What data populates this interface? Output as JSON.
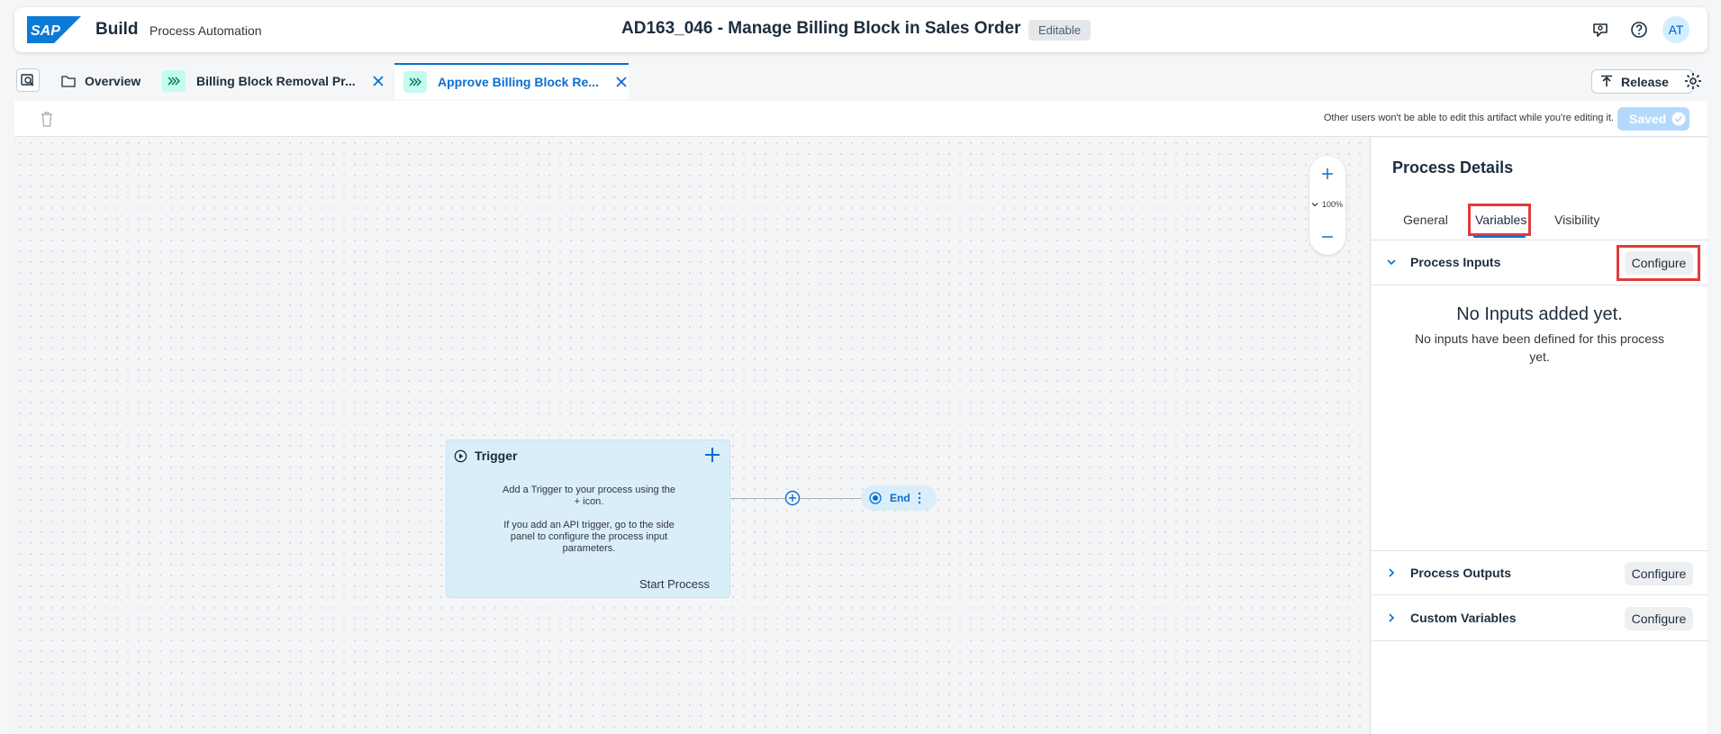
{
  "shell": {
    "logo_text": "SAP",
    "app_name": "Build",
    "app_sub": "Process Automation",
    "title": "AD163_046 - Manage Billing Block in Sales Order",
    "status_badge": "Editable",
    "avatar_initials": "AT",
    "icons": [
      "notifications-icon",
      "help-icon"
    ]
  },
  "tabs": {
    "overview_label": "Overview",
    "items": [
      {
        "label": "Billing Block Removal Pr...",
        "icon": "process-flow-icon",
        "active": false
      },
      {
        "label": "Approve Billing Block Re...",
        "icon": "process-flow-icon",
        "active": true
      }
    ],
    "release_label": "Release"
  },
  "toolbar": {
    "lock_note": "Other users won't be able to edit this artifact while you're editing it.",
    "saved_label": "Saved"
  },
  "canvas": {
    "zoom": "100%",
    "trigger": {
      "title": "Trigger",
      "desc_1": "Add a Trigger to your process using the + icon.",
      "desc_2": "If you add an API trigger, go to the side panel to configure the process input parameters.",
      "start_label": "Start Process"
    },
    "end_label": "End"
  },
  "panel": {
    "title": "Process Details",
    "tabs": [
      "General",
      "Variables",
      "Visibility"
    ],
    "active_tab": "Variables",
    "sections": [
      {
        "label": "Process Inputs",
        "expanded": true,
        "configure": "Configure"
      },
      {
        "label": "Process Outputs",
        "expanded": false,
        "configure": "Configure"
      },
      {
        "label": "Custom Variables",
        "expanded": false,
        "configure": "Configure"
      }
    ],
    "empty_title": "No Inputs added yet.",
    "empty_desc": "No inputs have been defined for this process yet."
  },
  "colors": {
    "accent": "#0a6ed1",
    "highlight": "#e23a3a",
    "flow_icon_bg": "#c2fcee",
    "node_bg": "#d9eef9"
  }
}
